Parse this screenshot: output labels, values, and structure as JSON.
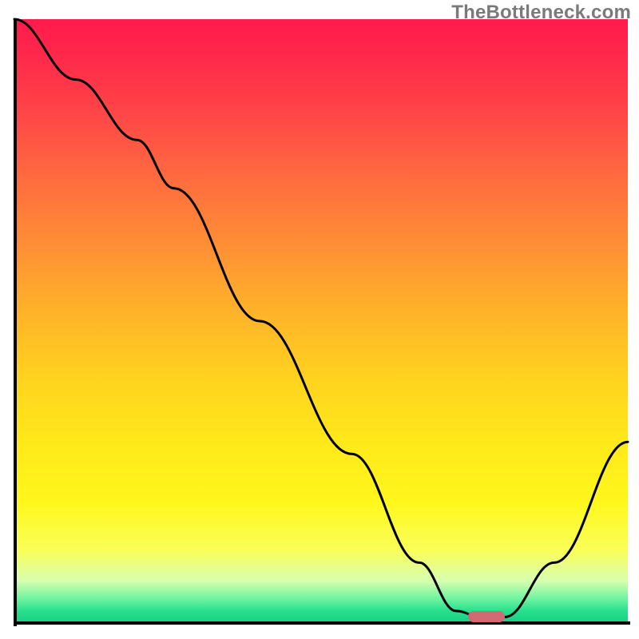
{
  "watermark": "TheBottleneck.com",
  "chart_data": {
    "type": "line",
    "title": "",
    "xlabel": "",
    "ylabel": "",
    "xlim": [
      0,
      100
    ],
    "ylim": [
      0,
      100
    ],
    "series": [
      {
        "name": "bottleneck-curve",
        "x": [
          0,
          10,
          20,
          26,
          40,
          55,
          66,
          72,
          76,
          80,
          88,
          100
        ],
        "y": [
          100,
          90,
          80,
          72,
          50,
          28,
          10,
          2,
          1,
          1,
          10,
          30
        ]
      }
    ],
    "annotations": [
      {
        "name": "optimal-marker",
        "x": 77,
        "y": 1,
        "color": "#d16a72"
      }
    ],
    "background": "rainbow-heat-gradient",
    "grid": false,
    "legend": false
  },
  "colors": {
    "curve": "#000000",
    "marker": "#d16a72",
    "axis": "#000000"
  }
}
